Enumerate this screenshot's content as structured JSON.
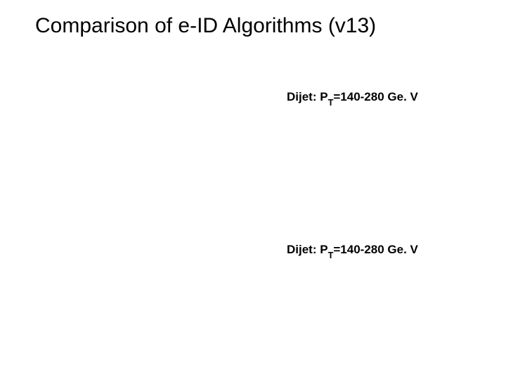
{
  "title": "Comparison of e-ID Algorithms (v13)",
  "labels": {
    "dijet_prefix": "Dijet: P",
    "dijet_sub": "T",
    "dijet_suffix": "=140-280 Ge. V"
  }
}
